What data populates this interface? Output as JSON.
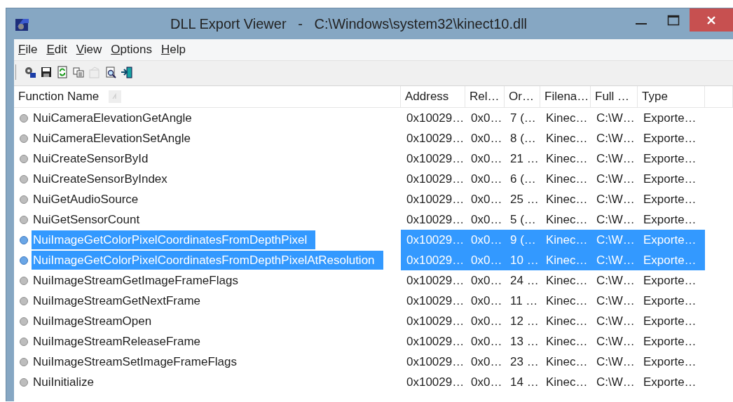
{
  "window": {
    "title": "DLL Export Viewer   -   C:\\Windows\\system32\\kinect10.dll"
  },
  "menu": [
    {
      "label": "File"
    },
    {
      "label": "Edit"
    },
    {
      "label": "View"
    },
    {
      "label": "Options"
    },
    {
      "label": "Help"
    }
  ],
  "toolbar": [
    {
      "kind": "properties"
    },
    {
      "kind": "save"
    },
    {
      "kind": "refresh"
    },
    {
      "kind": "copy"
    },
    {
      "kind": "report",
      "disabled": true
    },
    {
      "kind": "find"
    },
    {
      "kind": "exit"
    }
  ],
  "table": {
    "columns": [
      {
        "label": "Function Name",
        "sorted": true
      },
      {
        "label": "Address"
      },
      {
        "label": "Rel…"
      },
      {
        "label": "Or…"
      },
      {
        "label": "Filena…"
      },
      {
        "label": "Full …"
      },
      {
        "label": "Type"
      }
    ],
    "rows": [
      {
        "cells": [
          "NuiCameraElevationGetAngle",
          "0x10029…",
          "0x0…",
          "7 (…",
          "Kinec…",
          "C:\\W…",
          "Exporte…"
        ],
        "selected": false
      },
      {
        "cells": [
          "NuiCameraElevationSetAngle",
          "0x10029…",
          "0x0…",
          "8 (…",
          "Kinec…",
          "C:\\W…",
          "Exporte…"
        ],
        "selected": false
      },
      {
        "cells": [
          "NuiCreateSensorById",
          "0x10029…",
          "0x0…",
          "21 …",
          "Kinec…",
          "C:\\W…",
          "Exporte…"
        ],
        "selected": false
      },
      {
        "cells": [
          "NuiCreateSensorByIndex",
          "0x10029…",
          "0x0…",
          "6 (…",
          "Kinec…",
          "C:\\W…",
          "Exporte…"
        ],
        "selected": false
      },
      {
        "cells": [
          "NuiGetAudioSource",
          "0x10029…",
          "0x0…",
          "25 …",
          "Kinec…",
          "C:\\W…",
          "Exporte…"
        ],
        "selected": false
      },
      {
        "cells": [
          "NuiGetSensorCount",
          "0x10029…",
          "0x0…",
          "5 (…",
          "Kinec…",
          "C:\\W…",
          "Exporte…"
        ],
        "selected": false
      },
      {
        "cells": [
          "NuiImageGetColorPixelCoordinatesFromDepthPixel",
          "0x10029…",
          "0x0…",
          "9 (…",
          "Kinec…",
          "C:\\W…",
          "Exporte…"
        ],
        "selected": true
      },
      {
        "cells": [
          "NuiImageGetColorPixelCoordinatesFromDepthPixelAtResolution",
          "0x10029…",
          "0x0…",
          "10 …",
          "Kinec…",
          "C:\\W…",
          "Exporte…"
        ],
        "selected": true
      },
      {
        "cells": [
          "NuiImageStreamGetImageFrameFlags",
          "0x10029…",
          "0x0…",
          "24 …",
          "Kinec…",
          "C:\\W…",
          "Exporte…"
        ],
        "selected": false
      },
      {
        "cells": [
          "NuiImageStreamGetNextFrame",
          "0x10029…",
          "0x0…",
          "11 …",
          "Kinec…",
          "C:\\W…",
          "Exporte…"
        ],
        "selected": false
      },
      {
        "cells": [
          "NuiImageStreamOpen",
          "0x10029…",
          "0x0…",
          "12 …",
          "Kinec…",
          "C:\\W…",
          "Exporte…"
        ],
        "selected": false
      },
      {
        "cells": [
          "NuiImageStreamReleaseFrame",
          "0x10029…",
          "0x0…",
          "13 …",
          "Kinec…",
          "C:\\W…",
          "Exporte…"
        ],
        "selected": false
      },
      {
        "cells": [
          "NuiImageStreamSetImageFrameFlags",
          "0x10029…",
          "0x0…",
          "23 …",
          "Kinec…",
          "C:\\W…",
          "Exporte…"
        ],
        "selected": false
      },
      {
        "cells": [
          "NuiInitialize",
          "0x10029…",
          "0x0…",
          "14 …",
          "Kinec…",
          "C:\\W…",
          "Exporte…"
        ],
        "selected": false
      }
    ]
  }
}
